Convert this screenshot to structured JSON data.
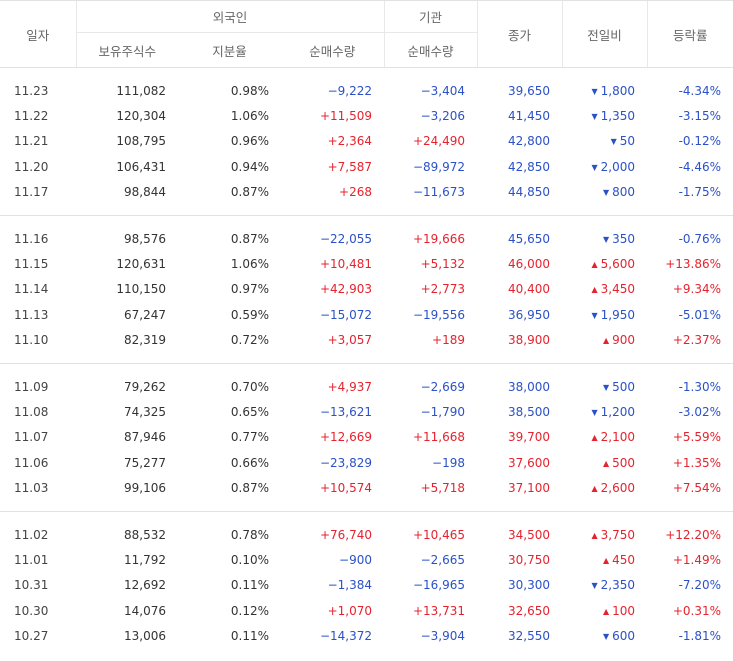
{
  "header": {
    "date": "일자",
    "foreign": "외국인",
    "institution": "기관",
    "close": "종가",
    "change": "전일비",
    "rate": "등락률",
    "holdings": "보유주식수",
    "share": "지분율",
    "net_foreign": "순매수량",
    "net_inst": "순매수량"
  },
  "groups": [
    [
      {
        "date": "11.23",
        "holdings": "111,082",
        "share": "0.98%",
        "fnet": "−9,222",
        "fdir": "dn",
        "inet": "−3,404",
        "idir": "dn",
        "close": "39,650",
        "cdir": "dn",
        "change": "1,800",
        "chdir": "dn",
        "rate": "-4.34%",
        "rdir": "dn"
      },
      {
        "date": "11.22",
        "holdings": "120,304",
        "share": "1.06%",
        "fnet": "+11,509",
        "fdir": "up",
        "inet": "−3,206",
        "idir": "dn",
        "close": "41,450",
        "cdir": "dn",
        "change": "1,350",
        "chdir": "dn",
        "rate": "-3.15%",
        "rdir": "dn"
      },
      {
        "date": "11.21",
        "holdings": "108,795",
        "share": "0.96%",
        "fnet": "+2,364",
        "fdir": "up",
        "inet": "+24,490",
        "idir": "up",
        "close": "42,800",
        "cdir": "dn",
        "change": "50",
        "chdir": "dn",
        "rate": "-0.12%",
        "rdir": "dn"
      },
      {
        "date": "11.20",
        "holdings": "106,431",
        "share": "0.94%",
        "fnet": "+7,587",
        "fdir": "up",
        "inet": "−89,972",
        "idir": "dn",
        "close": "42,850",
        "cdir": "dn",
        "change": "2,000",
        "chdir": "dn",
        "rate": "-4.46%",
        "rdir": "dn"
      },
      {
        "date": "11.17",
        "holdings": "98,844",
        "share": "0.87%",
        "fnet": "+268",
        "fdir": "up",
        "inet": "−11,673",
        "idir": "dn",
        "close": "44,850",
        "cdir": "dn",
        "change": "800",
        "chdir": "dn",
        "rate": "-1.75%",
        "rdir": "dn"
      }
    ],
    [
      {
        "date": "11.16",
        "holdings": "98,576",
        "share": "0.87%",
        "fnet": "−22,055",
        "fdir": "dn",
        "inet": "+19,666",
        "idir": "up",
        "close": "45,650",
        "cdir": "dn",
        "change": "350",
        "chdir": "dn",
        "rate": "-0.76%",
        "rdir": "dn"
      },
      {
        "date": "11.15",
        "holdings": "120,631",
        "share": "1.06%",
        "fnet": "+10,481",
        "fdir": "up",
        "inet": "+5,132",
        "idir": "up",
        "close": "46,000",
        "cdir": "up",
        "change": "5,600",
        "chdir": "up",
        "rate": "+13.86%",
        "rdir": "up"
      },
      {
        "date": "11.14",
        "holdings": "110,150",
        "share": "0.97%",
        "fnet": "+42,903",
        "fdir": "up",
        "inet": "+2,773",
        "idir": "up",
        "close": "40,400",
        "cdir": "up",
        "change": "3,450",
        "chdir": "up",
        "rate": "+9.34%",
        "rdir": "up"
      },
      {
        "date": "11.13",
        "holdings": "67,247",
        "share": "0.59%",
        "fnet": "−15,072",
        "fdir": "dn",
        "inet": "−19,556",
        "idir": "dn",
        "close": "36,950",
        "cdir": "dn",
        "change": "1,950",
        "chdir": "dn",
        "rate": "-5.01%",
        "rdir": "dn"
      },
      {
        "date": "11.10",
        "holdings": "82,319",
        "share": "0.72%",
        "fnet": "+3,057",
        "fdir": "up",
        "inet": "+189",
        "idir": "up",
        "close": "38,900",
        "cdir": "up",
        "change": "900",
        "chdir": "up",
        "rate": "+2.37%",
        "rdir": "up"
      }
    ],
    [
      {
        "date": "11.09",
        "holdings": "79,262",
        "share": "0.70%",
        "fnet": "+4,937",
        "fdir": "up",
        "inet": "−2,669",
        "idir": "dn",
        "close": "38,000",
        "cdir": "dn",
        "change": "500",
        "chdir": "dn",
        "rate": "-1.30%",
        "rdir": "dn"
      },
      {
        "date": "11.08",
        "holdings": "74,325",
        "share": "0.65%",
        "fnet": "−13,621",
        "fdir": "dn",
        "inet": "−1,790",
        "idir": "dn",
        "close": "38,500",
        "cdir": "dn",
        "change": "1,200",
        "chdir": "dn",
        "rate": "-3.02%",
        "rdir": "dn"
      },
      {
        "date": "11.07",
        "holdings": "87,946",
        "share": "0.77%",
        "fnet": "+12,669",
        "fdir": "up",
        "inet": "+11,668",
        "idir": "up",
        "close": "39,700",
        "cdir": "up",
        "change": "2,100",
        "chdir": "up",
        "rate": "+5.59%",
        "rdir": "up"
      },
      {
        "date": "11.06",
        "holdings": "75,277",
        "share": "0.66%",
        "fnet": "−23,829",
        "fdir": "dn",
        "inet": "−198",
        "idir": "dn",
        "close": "37,600",
        "cdir": "up",
        "change": "500",
        "chdir": "up",
        "rate": "+1.35%",
        "rdir": "up"
      },
      {
        "date": "11.03",
        "holdings": "99,106",
        "share": "0.87%",
        "fnet": "+10,574",
        "fdir": "up",
        "inet": "+5,718",
        "idir": "up",
        "close": "37,100",
        "cdir": "up",
        "change": "2,600",
        "chdir": "up",
        "rate": "+7.54%",
        "rdir": "up"
      }
    ],
    [
      {
        "date": "11.02",
        "holdings": "88,532",
        "share": "0.78%",
        "fnet": "+76,740",
        "fdir": "up",
        "inet": "+10,465",
        "idir": "up",
        "close": "34,500",
        "cdir": "up",
        "change": "3,750",
        "chdir": "up",
        "rate": "+12.20%",
        "rdir": "up"
      },
      {
        "date": "11.01",
        "holdings": "11,792",
        "share": "0.10%",
        "fnet": "−900",
        "fdir": "dn",
        "inet": "−2,665",
        "idir": "dn",
        "close": "30,750",
        "cdir": "up",
        "change": "450",
        "chdir": "up",
        "rate": "+1.49%",
        "rdir": "up"
      },
      {
        "date": "10.31",
        "holdings": "12,692",
        "share": "0.11%",
        "fnet": "−1,384",
        "fdir": "dn",
        "inet": "−16,965",
        "idir": "dn",
        "close": "30,300",
        "cdir": "dn",
        "change": "2,350",
        "chdir": "dn",
        "rate": "-7.20%",
        "rdir": "dn"
      },
      {
        "date": "10.30",
        "holdings": "14,076",
        "share": "0.12%",
        "fnet": "+1,070",
        "fdir": "up",
        "inet": "+13,731",
        "idir": "up",
        "close": "32,650",
        "cdir": "up",
        "change": "100",
        "chdir": "up",
        "rate": "+0.31%",
        "rdir": "up"
      },
      {
        "date": "10.27",
        "holdings": "13,006",
        "share": "0.11%",
        "fnet": "−14,372",
        "fdir": "dn",
        "inet": "−3,904",
        "idir": "dn",
        "close": "32,550",
        "cdir": "dn",
        "change": "600",
        "chdir": "dn",
        "rate": "-1.81%",
        "rdir": "dn"
      }
    ]
  ]
}
